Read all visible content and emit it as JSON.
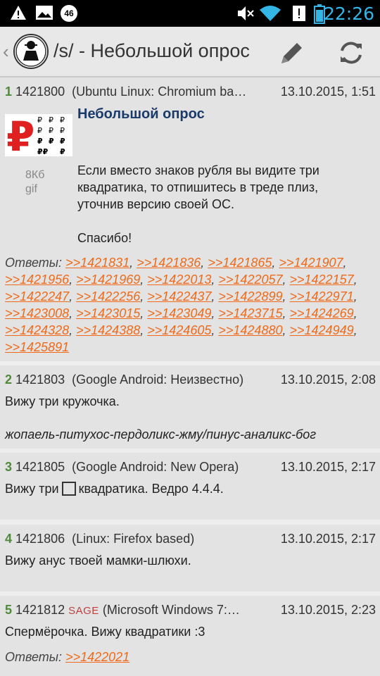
{
  "status_bar": {
    "time": "22:26",
    "notification_count": "46"
  },
  "app_bar": {
    "title": "/s/ - Небольшой опрос"
  },
  "posts": [
    {
      "index": "1",
      "id": "1421800",
      "client": "(Ubuntu Linux: Chromium ba…",
      "date": "13.10.2015, 1:51",
      "subject": "Небольшой опрос",
      "file_size": "8Кб",
      "file_type": "gif",
      "body_lines": [
        "Если вместо знаков рубля вы видите три",
        "квадратика, то отпишитесь в треде плиз,",
        "уточнив версию своей ОС.",
        "",
        "Спасибо!"
      ],
      "replies_label": "Ответы:",
      "replies": [
        ">>1421831",
        ">>1421836",
        ">>1421865",
        ">>1421907",
        ">>1421956",
        ">>1421969",
        ">>1422013",
        ">>1422057",
        ">>1422157",
        ">>1422247",
        ">>1422256",
        ">>1422437",
        ">>1422899",
        ">>1422971",
        ">>1423008",
        ">>1423015",
        ">>1423049",
        ">>1423715",
        ">>1424269",
        ">>1424328",
        ">>1424388",
        ">>1424605",
        ">>1424880",
        ">>1424949",
        ">>1425891"
      ]
    },
    {
      "index": "2",
      "id": "1421803",
      "client": "(Google Android: Неизвестно)",
      "date": "13.10.2015, 2:08",
      "body": "Вижу три кружочка.",
      "signature": "жопаель-питухос-пердоликс-жму/пинус-аналикс-бог"
    },
    {
      "index": "3",
      "id": "1421805",
      "client": "(Google Android: New Opera)",
      "date": "13.10.2015, 2:17",
      "body_before": "Вижу три",
      "body_after": "квадратика. Ведро 4.4.4."
    },
    {
      "index": "4",
      "id": "1421806",
      "client": "(Linux: Firefox based)",
      "date": "13.10.2015, 2:17",
      "body": "Вижу анус твоей мамки-шлюхи."
    },
    {
      "index": "5",
      "id": "1421812",
      "sage": "SAGE",
      "client": "(Microsoft Windows 7:…",
      "date": "13.10.2015, 2:23",
      "body": "Спермёрочка. Вижу квадратики :3",
      "replies_label": "Ответы:",
      "replies": [
        ">>1422021"
      ]
    }
  ]
}
